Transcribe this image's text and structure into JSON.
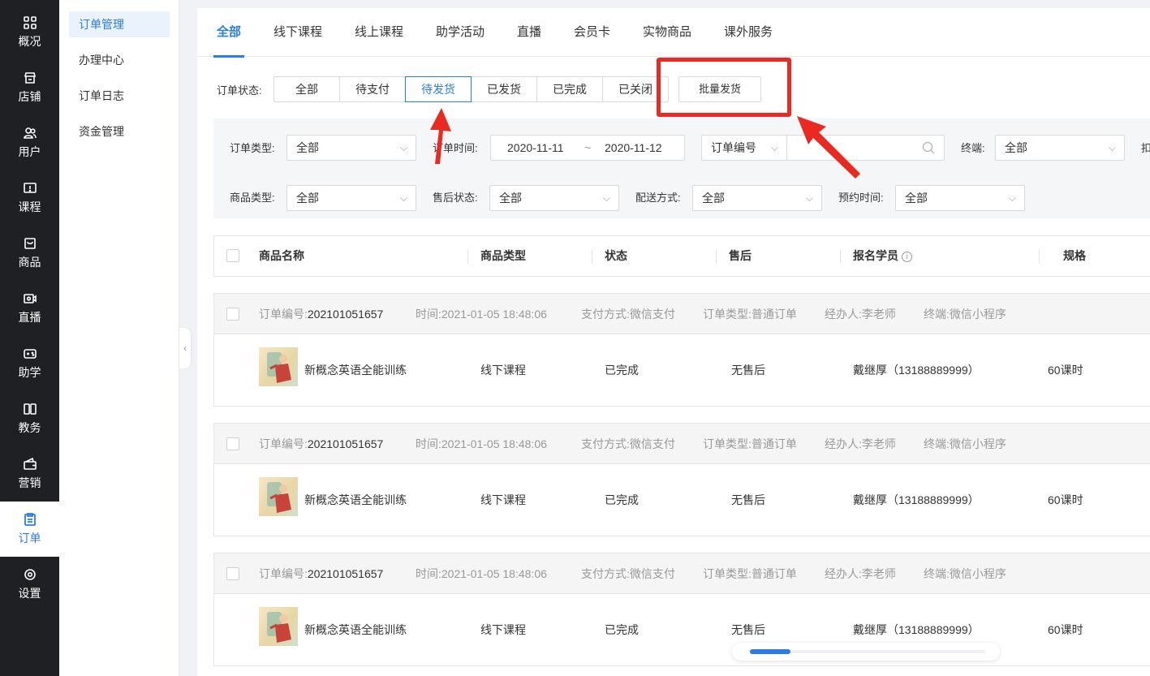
{
  "nav": [
    {
      "label": "概况",
      "icon": "grid-icon"
    },
    {
      "label": "店铺",
      "icon": "store-icon"
    },
    {
      "label": "用户",
      "icon": "users-icon"
    },
    {
      "label": "课程",
      "icon": "course-icon"
    },
    {
      "label": "商品",
      "icon": "bag-icon"
    },
    {
      "label": "直播",
      "icon": "live-camera-icon"
    },
    {
      "label": "助学",
      "icon": "gamepad-icon"
    },
    {
      "label": "教务",
      "icon": "book-icon"
    },
    {
      "label": "营销",
      "icon": "wallet-icon"
    },
    {
      "label": "订单",
      "icon": "clipboard-icon"
    },
    {
      "label": "设置",
      "icon": "settings-icon"
    }
  ],
  "nav_active": "订单",
  "submenu": [
    "订单管理",
    "办理中心",
    "订单日志",
    "资金管理"
  ],
  "tabs": [
    "全部",
    "线下课程",
    "线上课程",
    "助学活动",
    "直播",
    "会员卡",
    "实物商品",
    "课外服务"
  ],
  "status": {
    "label": "订单状态:",
    "options": [
      "全部",
      "待支付",
      "待发货",
      "已发货",
      "已完成",
      "已关闭"
    ],
    "selected": "待发货"
  },
  "batch_button": "批量发货",
  "filters": {
    "order_type_label": "订单类型:",
    "order_type_value": "全部",
    "order_time_label": "订单时间:",
    "date_start": "2020-11-11",
    "date_sep": "~",
    "date_end": "2020-11-12",
    "order_no_select": "订单编号",
    "terminal_label": "终端:",
    "terminal_value": "全部",
    "cut_label": "扣",
    "goods_type_label": "商品类型:",
    "goods_type_value": "全部",
    "after_sale_label": "售后状态:",
    "after_sale_value": "全部",
    "delivery_label": "配送方式:",
    "delivery_value": "全部",
    "appointment_label": "预约时间:",
    "appointment_value": "全部"
  },
  "table_headers": [
    "商品名称",
    "商品类型",
    "状态",
    "售后",
    "报名学员",
    "规格"
  ],
  "orders": [
    {
      "no_label": "订单编号:",
      "no": "202101051657",
      "time_label": "时间:",
      "time": "2021-01-05 18:48:06",
      "pay_label": "支付方式:",
      "pay": "微信支付",
      "type_label": "订单类型:",
      "type": "普通订单",
      "handler_label": "经办人:",
      "handler": "李老师",
      "terminal_label": "终端:",
      "terminal": "微信小程序",
      "product": "新概念英语全能训练",
      "product_type": "线下课程",
      "status": "已完成",
      "after_sale": "无售后",
      "student": "戴继厚（13188889999）",
      "spec": "60课时"
    },
    {
      "no_label": "订单编号:",
      "no": "202101051657",
      "time_label": "时间:",
      "time": "2021-01-05 18:48:06",
      "pay_label": "支付方式:",
      "pay": "微信支付",
      "type_label": "订单类型:",
      "type": "普通订单",
      "handler_label": "经办人:",
      "handler": "李老师",
      "terminal_label": "终端:",
      "terminal": "微信小程序",
      "product": "新概念英语全能训练",
      "product_type": "线下课程",
      "status": "已完成",
      "after_sale": "无售后",
      "student": "戴继厚（13188889999）",
      "spec": "60课时"
    },
    {
      "no_label": "订单编号:",
      "no": "202101051657",
      "time_label": "时间:",
      "time": "2021-01-05 18:48:06",
      "pay_label": "支付方式:",
      "pay": "微信支付",
      "type_label": "订单类型:",
      "type": "普通订单",
      "handler_label": "经办人:",
      "handler": "李老师",
      "terminal_label": "终端:",
      "terminal": "微信小程序",
      "product": "新概念英语全能训练",
      "product_type": "线下课程",
      "status": "已完成",
      "after_sale": "无售后",
      "student": "戴继厚（13188889999）",
      "spec": "60课时"
    }
  ],
  "colors": {
    "primary": "#2b7de0",
    "annotation": "#ea2a21",
    "nav_bg": "#1f2023"
  }
}
